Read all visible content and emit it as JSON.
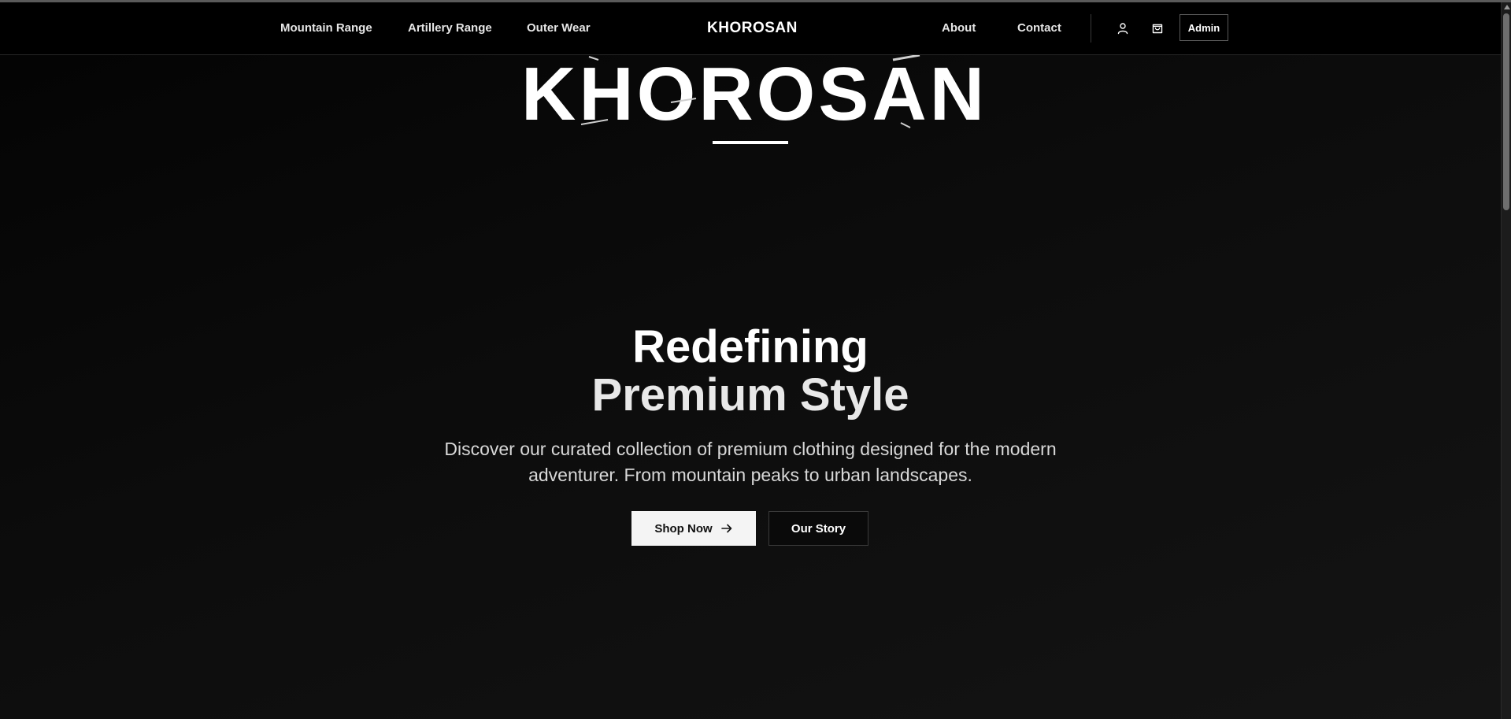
{
  "header": {
    "nav_left": [
      "Mountain Range",
      "Artillery Range",
      "Outer Wear"
    ],
    "brand": "KHOROSAN",
    "nav_right": [
      "About",
      "Contact"
    ],
    "icons": [
      "user-icon",
      "shopping-bag-icon"
    ],
    "admin_label": "Admin"
  },
  "hero": {
    "logo_text": "KHOROSAN",
    "title_line1": "Redefining",
    "title_line2": "Premium Style",
    "subtitle": "Discover our curated collection of premium clothing designed for the modern adventurer. From mountain peaks to urban landscapes.",
    "shop_label": "Shop Now",
    "story_label": "Our Story"
  },
  "colors": {
    "background": "#0b0b0b",
    "header": "#000000",
    "primary_button": "#f4f4f4",
    "text": "#ffffff"
  }
}
